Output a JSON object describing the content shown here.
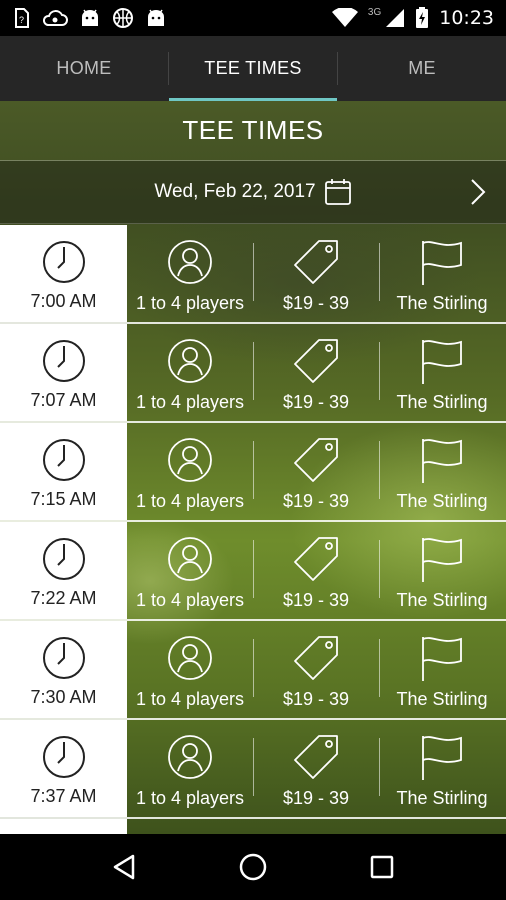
{
  "status_bar": {
    "time": "10:23",
    "network_label": "3G",
    "left_icons": [
      "sim-card-icon",
      "cloud-icon",
      "android-icon",
      "basketball-icon",
      "android-icon"
    ],
    "right_icons": [
      "wifi-icon",
      "signal-icon",
      "battery-icon"
    ]
  },
  "tabs": [
    {
      "label": "HOME",
      "active": false
    },
    {
      "label": "TEE TIMES",
      "active": true
    },
    {
      "label": "ME",
      "active": false
    }
  ],
  "page": {
    "title": "TEE TIMES",
    "date": "Wed, Feb 22, 2017"
  },
  "colors": {
    "accent": "#6fc7c4",
    "tab_bar": "#262626",
    "time_cell": "#ffffff"
  },
  "tee_times": [
    {
      "time": "7:00 AM",
      "players": "1 to 4 players",
      "price": "$19 - 39",
      "course": "The Stirling"
    },
    {
      "time": "7:07 AM",
      "players": "1 to 4 players",
      "price": "$19 - 39",
      "course": "The Stirling"
    },
    {
      "time": "7:15 AM",
      "players": "1 to 4 players",
      "price": "$19 - 39",
      "course": "The Stirling"
    },
    {
      "time": "7:22 AM",
      "players": "1 to 4 players",
      "price": "$19 - 39",
      "course": "The Stirling"
    },
    {
      "time": "7:30 AM",
      "players": "1 to 4 players",
      "price": "$19 - 39",
      "course": "The Stirling"
    },
    {
      "time": "7:37 AM",
      "players": "1 to 4 players",
      "price": "$19 - 39",
      "course": "The Stirling"
    }
  ],
  "nav": {
    "icons": [
      "back-icon",
      "home-icon",
      "recents-icon"
    ]
  }
}
